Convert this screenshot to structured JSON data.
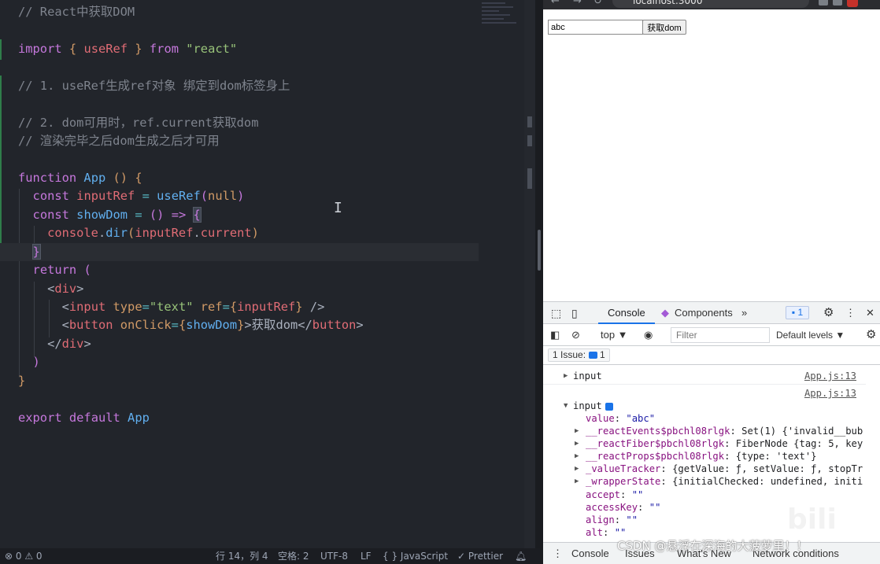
{
  "editor": {
    "lines": [
      {
        "id": "l1",
        "tokens": [
          [
            "c-comment",
            "// React中获取DOM"
          ]
        ]
      },
      {
        "id": "l2",
        "tokens": []
      },
      {
        "id": "l3",
        "tokens": [
          [
            "c-kw",
            "import"
          ],
          [
            "c-punc",
            " "
          ],
          [
            "c-paren",
            "{"
          ],
          [
            "c-punc",
            " "
          ],
          [
            "c-var",
            "useRef"
          ],
          [
            "c-punc",
            " "
          ],
          [
            "c-paren",
            "}"
          ],
          [
            "c-punc",
            " "
          ],
          [
            "c-kw",
            "from"
          ],
          [
            "c-punc",
            " "
          ],
          [
            "c-str",
            "\"react\""
          ]
        ]
      },
      {
        "id": "l4",
        "tokens": []
      },
      {
        "id": "l5",
        "tokens": [
          [
            "c-comment",
            "// 1. useRef生成ref对象 绑定到dom标签身上"
          ]
        ]
      },
      {
        "id": "l6",
        "tokens": []
      },
      {
        "id": "l7",
        "tokens": [
          [
            "c-comment",
            "// 2. dom可用时，ref.current获取dom"
          ]
        ]
      },
      {
        "id": "l8",
        "tokens": [
          [
            "c-comment",
            "// 渲染完毕之后dom生成之后才可用"
          ]
        ]
      },
      {
        "id": "l9",
        "tokens": []
      },
      {
        "id": "l10",
        "tokens": [
          [
            "c-kw",
            "function"
          ],
          [
            "c-punc",
            " "
          ],
          [
            "c-fn",
            "App"
          ],
          [
            "c-punc",
            " "
          ],
          [
            "c-paren",
            "()"
          ],
          [
            "c-punc",
            " "
          ],
          [
            "c-paren",
            "{"
          ]
        ]
      },
      {
        "id": "l11",
        "tokens": [
          [
            "c-punc",
            "  "
          ],
          [
            "c-kw",
            "const"
          ],
          [
            "c-punc",
            " "
          ],
          [
            "c-var",
            "inputRef"
          ],
          [
            "c-punc",
            " "
          ],
          [
            "c-op",
            "="
          ],
          [
            "c-punc",
            " "
          ],
          [
            "c-fn",
            "useRef"
          ],
          [
            "c-brace",
            "("
          ],
          [
            "c-attr",
            "null"
          ],
          [
            "c-brace",
            ")"
          ]
        ]
      },
      {
        "id": "l12",
        "tokens": [
          [
            "c-punc",
            "  "
          ],
          [
            "c-kw",
            "const"
          ],
          [
            "c-punc",
            " "
          ],
          [
            "c-fn",
            "showDom"
          ],
          [
            "c-punc",
            " "
          ],
          [
            "c-op",
            "="
          ],
          [
            "c-punc",
            " "
          ],
          [
            "c-brace",
            "()"
          ],
          [
            "c-punc",
            " "
          ],
          [
            "c-kw",
            "=>"
          ],
          [
            "c-punc",
            " "
          ],
          [
            "c-brace bracket-hl",
            "{"
          ]
        ]
      },
      {
        "id": "l13",
        "tokens": [
          [
            "c-punc",
            "    "
          ],
          [
            "c-var",
            "console"
          ],
          [
            "c-punc",
            "."
          ],
          [
            "c-fn",
            "dir"
          ],
          [
            "c-paren",
            "("
          ],
          [
            "c-var",
            "inputRef"
          ],
          [
            "c-punc",
            "."
          ],
          [
            "c-var",
            "current"
          ],
          [
            "c-paren",
            ")"
          ]
        ]
      },
      {
        "id": "l14",
        "tokens": [
          [
            "c-punc",
            "  "
          ],
          [
            "c-brace bracket-hl",
            "}"
          ]
        ],
        "current": true
      },
      {
        "id": "l15",
        "tokens": [
          [
            "c-punc",
            "  "
          ],
          [
            "c-kw",
            "return"
          ],
          [
            "c-punc",
            " "
          ],
          [
            "c-brace",
            "("
          ]
        ]
      },
      {
        "id": "l16",
        "tokens": [
          [
            "c-punc",
            "    "
          ],
          [
            "c-punc",
            "<"
          ],
          [
            "c-tag",
            "div"
          ],
          [
            "c-punc",
            ">"
          ]
        ]
      },
      {
        "id": "l17",
        "tokens": [
          [
            "c-punc",
            "      "
          ],
          [
            "c-punc",
            "<"
          ],
          [
            "c-tag",
            "input"
          ],
          [
            "c-punc",
            " "
          ],
          [
            "c-attr",
            "type"
          ],
          [
            "c-op",
            "="
          ],
          [
            "c-str",
            "\"text\""
          ],
          [
            "c-punc",
            " "
          ],
          [
            "c-attr",
            "ref"
          ],
          [
            "c-op",
            "="
          ],
          [
            "c-paren",
            "{"
          ],
          [
            "c-var",
            "inputRef"
          ],
          [
            "c-paren",
            "}"
          ],
          [
            "c-punc",
            " />"
          ]
        ]
      },
      {
        "id": "l18",
        "tokens": [
          [
            "c-punc",
            "      "
          ],
          [
            "c-punc",
            "<"
          ],
          [
            "c-tag",
            "button"
          ],
          [
            "c-punc",
            " "
          ],
          [
            "c-attr",
            "onClick"
          ],
          [
            "c-op",
            "="
          ],
          [
            "c-paren",
            "{"
          ],
          [
            "c-fn",
            "showDom"
          ],
          [
            "c-paren",
            "}"
          ],
          [
            "c-punc",
            ">"
          ],
          [
            "c-text",
            "获取dom"
          ],
          [
            "c-punc",
            "</"
          ],
          [
            "c-tag",
            "button"
          ],
          [
            "c-punc",
            ">"
          ]
        ]
      },
      {
        "id": "l19",
        "tokens": [
          [
            "c-punc",
            "    "
          ],
          [
            "c-punc",
            "</"
          ],
          [
            "c-tag",
            "div"
          ],
          [
            "c-punc",
            ">"
          ]
        ]
      },
      {
        "id": "l20",
        "tokens": [
          [
            "c-punc",
            "  "
          ],
          [
            "c-brace",
            ")"
          ]
        ]
      },
      {
        "id": "l21",
        "tokens": [
          [
            "c-paren",
            "}"
          ]
        ]
      },
      {
        "id": "l22",
        "tokens": []
      },
      {
        "id": "l23",
        "tokens": [
          [
            "c-kw",
            "export"
          ],
          [
            "c-punc",
            " "
          ],
          [
            "c-kw",
            "default"
          ],
          [
            "c-punc",
            " "
          ],
          [
            "c-fn",
            "App"
          ]
        ]
      }
    ]
  },
  "statusbar": {
    "problems": "⊗ 0 ⚠ 0",
    "position": "行 14，列 4",
    "spaces": "空格: 2",
    "encoding": "UTF-8",
    "eol": "LF",
    "language": "{ } JavaScript",
    "formatter": "✓ Prettier",
    "notifications_icon": "bell-icon"
  },
  "browser": {
    "url": "localhost:3000",
    "input_value": "abc",
    "button_label": "获取dom"
  },
  "devtools": {
    "tabs": [
      "Console",
      "Components"
    ],
    "more": "»",
    "message_count": "1",
    "context": "top ▼",
    "filter_placeholder": "Filter",
    "levels": "Default levels ▼",
    "issues_label": "1 Issue:",
    "issues_count": "1",
    "console_rows": [
      {
        "tri": "▶",
        "text": "input",
        "link": "App.js:13",
        "indent": 0
      },
      {
        "tri": "",
        "text": "",
        "link": "App.js:13",
        "indent": 0
      },
      {
        "tri": "▼",
        "text": "input",
        "link": "",
        "indent": 0,
        "info": true
      },
      {
        "tri": "",
        "key": "value",
        "val": "\"abc\"",
        "indent": 1
      },
      {
        "tri": "▶",
        "key": "__reactEvents$pbchl08rlgk",
        "val": "Set(1) {'invalid__bub",
        "indent": 1
      },
      {
        "tri": "▶",
        "key": "__reactFiber$pbchl08rlgk",
        "val": "FiberNode {tag: 5, key",
        "indent": 1
      },
      {
        "tri": "▶",
        "key": "__reactProps$pbchl08rlgk",
        "val": "{type: 'text'}",
        "indent": 1
      },
      {
        "tri": "▶",
        "key": "_valueTracker",
        "val": "{getValue: ƒ, setValue: ƒ, stopTr",
        "indent": 1
      },
      {
        "tri": "▶",
        "key": "_wrapperState",
        "val": "{initialChecked: undefined, initi",
        "indent": 1
      },
      {
        "tri": "",
        "key": "accept",
        "val": "\"\"",
        "indent": 1
      },
      {
        "tri": "",
        "key": "accessKey",
        "val": "\"\"",
        "indent": 1
      },
      {
        "tri": "",
        "key": "align",
        "val": "\"\"",
        "indent": 1
      },
      {
        "tri": "",
        "key": "alt",
        "val": "\"\"",
        "indent": 1
      }
    ],
    "drawer_tabs": [
      "Console",
      "Issues",
      "What's New",
      "Network conditions"
    ]
  },
  "watermark": "CSDN @悬浮在深海的大菠萝里！！",
  "colors": {
    "accent": "#1a73e8",
    "editor_bg": "#22252b",
    "gutter_added": "#2f7d4a"
  }
}
